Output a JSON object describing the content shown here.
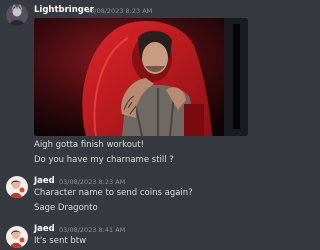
{
  "messages": [
    {
      "author": "Lightbringer",
      "timestamp": "03/08/2023 8:23 AM",
      "attachment_icon": "image-attachment",
      "lines": [
        "Aigh gotta finish workout!",
        "Do you have my charname still ?"
      ]
    },
    {
      "author": "Jaed",
      "timestamp": "03/08/2023 8:23 AM",
      "lines": [
        "Character name to send coins again?",
        "Sage Dragonto"
      ]
    },
    {
      "author": "Jaed",
      "timestamp": "03/08/2023 8:41 AM",
      "lines": [
        "It's sent btw"
      ]
    }
  ],
  "colors": {
    "background": "#36393f",
    "username": "#ffffff",
    "timestamp": "#8e9297",
    "text": "#dcddde"
  }
}
